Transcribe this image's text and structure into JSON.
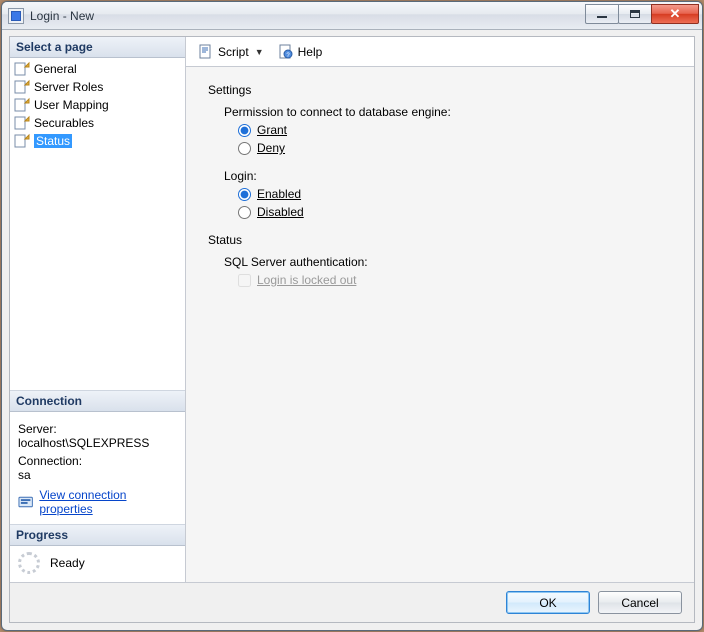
{
  "window": {
    "title": "Login - New"
  },
  "sidebar": {
    "select_page_header": "Select a page",
    "pages": [
      {
        "label": "General"
      },
      {
        "label": "Server Roles"
      },
      {
        "label": "User Mapping"
      },
      {
        "label": "Securables"
      },
      {
        "label": "Status",
        "selected": true
      }
    ],
    "connection_header": "Connection",
    "connection": {
      "server_label": "Server:",
      "server_value": "localhost\\SQLEXPRESS",
      "connection_label": "Connection:",
      "connection_value": "sa",
      "view_props_link": "View connection properties"
    },
    "progress_header": "Progress",
    "progress": {
      "status": "Ready"
    }
  },
  "toolbar": {
    "script_label": "Script",
    "help_label": "Help"
  },
  "main": {
    "settings_header": "Settings",
    "perm_label": "Permission to connect to database engine:",
    "perm_grant": "Grant",
    "perm_deny": "Deny",
    "login_label": "Login:",
    "login_enabled": "Enabled",
    "login_disabled": "Disabled",
    "status_header": "Status",
    "sql_auth_label": "SQL Server authentication:",
    "locked_out_label": "Login is locked out"
  },
  "buttons": {
    "ok": "OK",
    "cancel": "Cancel"
  }
}
